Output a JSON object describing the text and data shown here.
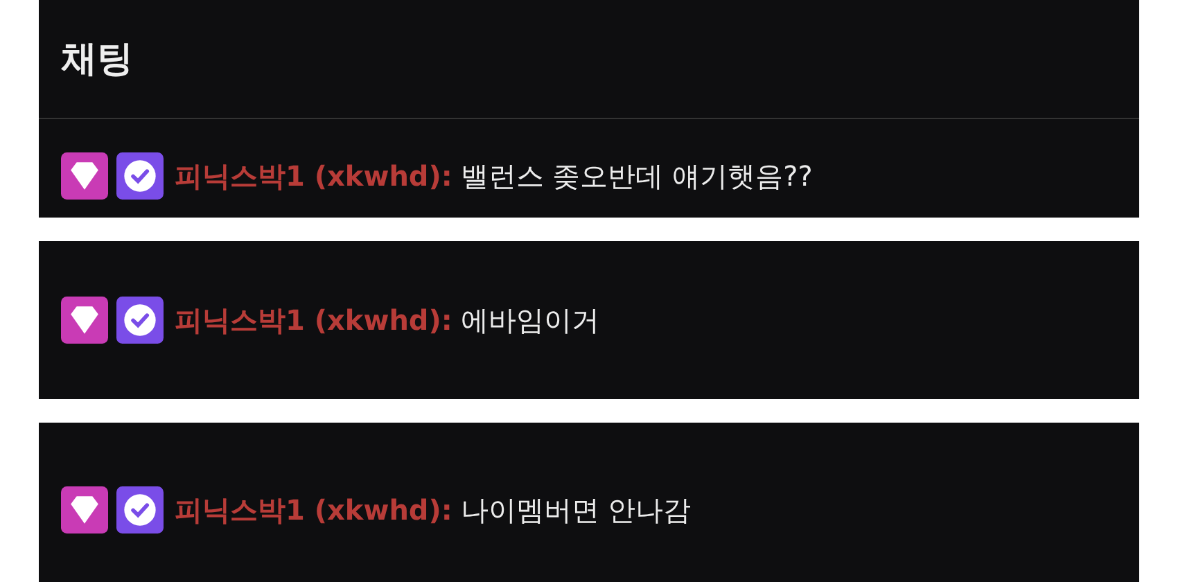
{
  "panels": [
    {
      "header": "채팅",
      "messages": [
        {
          "user": "피닉스박1 (xkwhd):",
          "text": "밸런스 좆오반데 얘기햇음??"
        }
      ]
    },
    {
      "messages": [
        {
          "user": "피닉스박1 (xkwhd):",
          "text": "에바임이거"
        }
      ]
    },
    {
      "messages": [
        {
          "user": "피닉스박1 (xkwhd):",
          "text": "나이멤버면 안나감"
        }
      ]
    }
  ]
}
